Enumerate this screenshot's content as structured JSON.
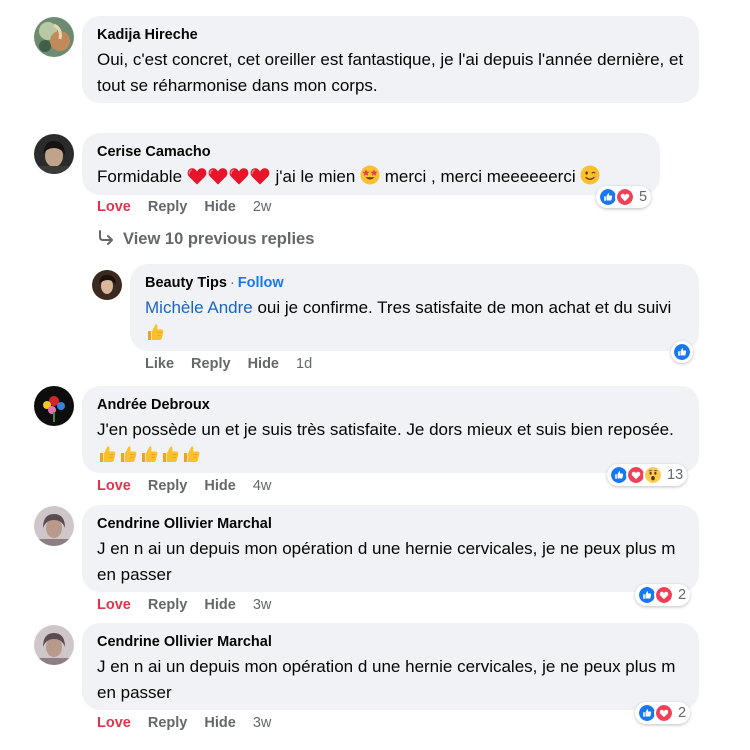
{
  "comments": [
    {
      "name": "Kadija Hireche",
      "text": "Oui, c'est concret, cet oreiller est fantastique, je l'ai depuis l'année dernière, et tout se réharmonise dans mon corps."
    },
    {
      "name": "Cerise Camacho",
      "text_prefix": "Formidable",
      "text_middle": "j'ai le mien",
      "text_suffix": "merci , merci meeeeeerci",
      "actions": {
        "love": "Love",
        "reply": "Reply",
        "hide": "Hide",
        "time": "2w"
      },
      "reactions": {
        "count": "5",
        "icons": [
          "like-icon",
          "heart-icon"
        ]
      }
    },
    {
      "name": "Andrée Debroux",
      "text": "J'en possède un et je suis très satisfaite. Je dors mieux et suis bien reposée.",
      "actions": {
        "love": "Love",
        "reply": "Reply",
        "hide": "Hide",
        "time": "4w"
      },
      "reactions": {
        "count": "13",
        "icons": [
          "like-icon",
          "heart-icon",
          "wow-icon"
        ]
      }
    },
    {
      "name": "Cendrine Ollivier Marchal",
      "text": "J en n ai un depuis mon opération d une hernie cervicales, je ne peux plus m en passer",
      "actions": {
        "love": "Love",
        "reply": "Reply",
        "hide": "Hide",
        "time": "3w"
      },
      "reactions": {
        "count": "2",
        "icons": [
          "like-icon",
          "heart-icon"
        ]
      }
    },
    {
      "name": "Cendrine Ollivier Marchal",
      "text": "J en n ai un depuis mon opération d une hernie cervicales, je ne peux plus m en passer",
      "actions": {
        "love": "Love",
        "reply": "Reply",
        "hide": "Hide",
        "time": "3w"
      },
      "reactions": {
        "count": "2",
        "icons": [
          "like-icon",
          "heart-icon"
        ]
      }
    }
  ],
  "view_replies": "View 10 previous replies",
  "reply": {
    "name": "Beauty Tips",
    "separator": "·",
    "follow": "Follow",
    "mention": "Michèle Andre",
    "text": "oui je confirme. Tres satisfaite de mon achat et du suivi",
    "actions": {
      "like": "Like",
      "reply": "Reply",
      "hide": "Hide",
      "time": "1d"
    },
    "reactions": {
      "icons": [
        "like-icon"
      ]
    }
  },
  "colors": {
    "like": "#1877f2",
    "love_reaction": "#f33e58",
    "love_action": "#e0334f",
    "bubble": "#f0f2f5",
    "muted": "#65676b"
  }
}
